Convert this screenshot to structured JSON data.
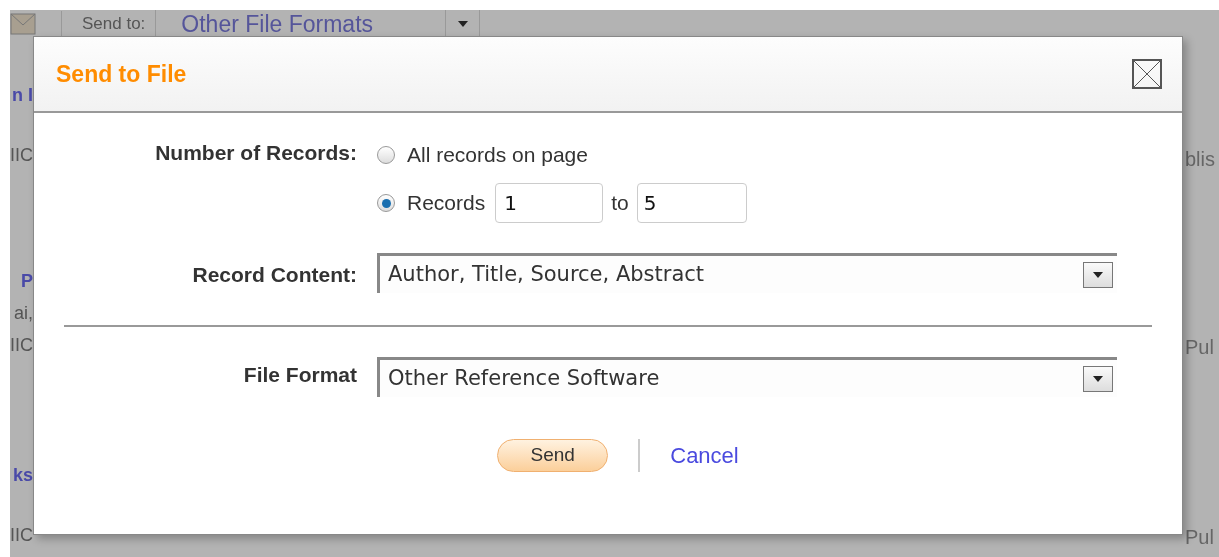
{
  "page": {
    "toolbar": {
      "send_to_label": "Send to:",
      "send_to_value": "Other File Formats"
    },
    "left_fragments": [
      {
        "text": "n I",
        "kind": "link"
      },
      {
        "text": "IIC",
        "kind": "text"
      },
      {
        "text": "P",
        "kind": "link"
      },
      {
        "text": "ai,",
        "kind": "text"
      },
      {
        "text": "IIC",
        "kind": "text"
      },
      {
        "text": "ks",
        "kind": "link"
      },
      {
        "text": "IIC",
        "kind": "text"
      }
    ],
    "right_fragments": [
      {
        "text": "blis"
      },
      {
        "text": "Pul"
      },
      {
        "text": "Pul"
      }
    ]
  },
  "dialog": {
    "title": "Send to File",
    "number_of_records": {
      "label": "Number of Records:",
      "options": [
        {
          "label": "All records on page",
          "selected": false
        },
        {
          "label": "Records",
          "selected": true,
          "from": "1",
          "to_label": "to",
          "to": "5"
        }
      ]
    },
    "record_content": {
      "label": "Record Content:",
      "value": "Author, Title, Source, Abstract"
    },
    "file_format": {
      "label": "File Format",
      "value": "Other Reference Software"
    },
    "buttons": {
      "send": "Send",
      "cancel": "Cancel"
    }
  }
}
